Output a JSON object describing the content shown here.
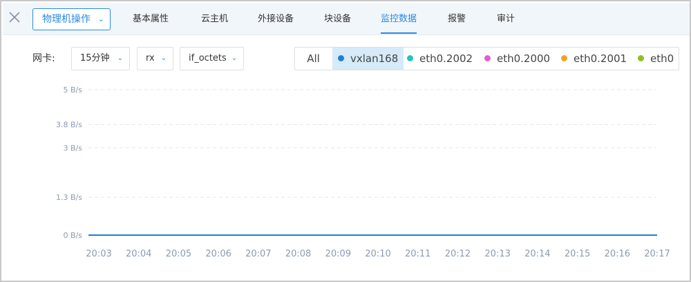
{
  "header": {
    "ops_button": {
      "label": "物理机操作",
      "icon": "chevron-down-icon"
    },
    "tabs": [
      {
        "label": "基本属性",
        "active": false
      },
      {
        "label": "云主机",
        "active": false
      },
      {
        "label": "外接设备",
        "active": false
      },
      {
        "label": "块设备",
        "active": false
      },
      {
        "label": "监控数据",
        "active": true
      },
      {
        "label": "报警",
        "active": false
      },
      {
        "label": "审计",
        "active": false
      }
    ],
    "close_icon": "close-icon",
    "accent_color": "#2a8ae0"
  },
  "filters": {
    "nic_label": "网卡:",
    "time_range": "15分钟",
    "direction": "rx",
    "metric": "if_octets"
  },
  "legend": {
    "all_label": "All",
    "items": [
      {
        "label": "vxlan168",
        "color": "#1f7ed6",
        "selected": true
      },
      {
        "label": "eth0.2002",
        "color": "#20c4c0",
        "selected": false
      },
      {
        "label": "eth0.2000",
        "color": "#e55ad8",
        "selected": false
      },
      {
        "label": "eth0.2001",
        "color": "#f0a12a",
        "selected": false
      },
      {
        "label": "eth0",
        "color": "#8fbf1f",
        "selected": false
      }
    ]
  },
  "chart_data": {
    "type": "line",
    "title": "",
    "xlabel": "",
    "ylabel": "",
    "y_ticks": [
      "5 B/s",
      "3.8 B/s",
      "3 B/s",
      "1.3 B/s",
      "0 B/s"
    ],
    "y_tick_values": [
      5,
      3.8,
      3,
      1.3,
      0
    ],
    "ylim": [
      0,
      5
    ],
    "grid": true,
    "categories": [
      "20:03",
      "20:04",
      "20:05",
      "20:06",
      "20:07",
      "20:08",
      "20:09",
      "20:10",
      "20:11",
      "20:12",
      "20:13",
      "20:14",
      "20:15",
      "20:16",
      "20:17"
    ],
    "series": [
      {
        "name": "vxlan168",
        "color": "#1f7ed6",
        "values": [
          0,
          0,
          0,
          0,
          0,
          0,
          0,
          0,
          0,
          0,
          0,
          0,
          0,
          0,
          0
        ]
      }
    ]
  }
}
